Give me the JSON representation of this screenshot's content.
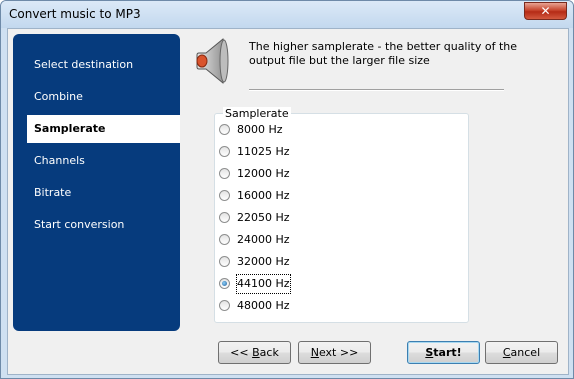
{
  "window": {
    "title": "Convert music to MP3",
    "close_glyph": "✕"
  },
  "sidebar": {
    "items": [
      {
        "label": "Select destination",
        "active": false
      },
      {
        "label": "Combine",
        "active": false
      },
      {
        "label": "Samplerate",
        "active": true
      },
      {
        "label": "Channels",
        "active": false
      },
      {
        "label": "Bitrate",
        "active": false
      },
      {
        "label": "Start conversion",
        "active": false
      }
    ]
  },
  "header": {
    "icon": "speaker-icon",
    "description": "The higher samplerate  - the better quality of the output file but the larger file size"
  },
  "samplerate": {
    "group_label": "Samplerate",
    "options": [
      "8000 Hz",
      "11025 Hz",
      "12000 Hz",
      "16000 Hz",
      "22050 Hz",
      "24000 Hz",
      "32000 Hz",
      "44100 Hz",
      "48000 Hz"
    ],
    "selected": "44100 Hz"
  },
  "buttons": {
    "back": {
      "prefix": "<< ",
      "mnemonic": "B",
      "rest": "ack"
    },
    "next": {
      "prefix": "",
      "mnemonic": "N",
      "rest": "ext >>"
    },
    "start": {
      "prefix": "",
      "mnemonic": "S",
      "rest": "tart!"
    },
    "cancel": {
      "prefix": "",
      "mnemonic": "C",
      "rest": "ancel"
    }
  },
  "colors": {
    "sidebar_bg": "#063b7d",
    "window_frame": "#cfe0f1",
    "close_button": "#c7462e"
  }
}
